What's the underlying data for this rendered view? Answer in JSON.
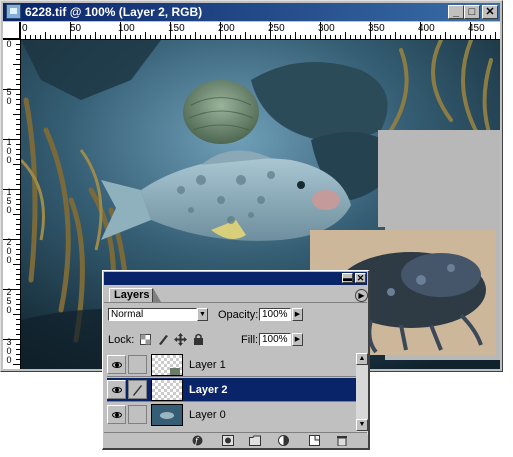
{
  "document": {
    "title": "6228.tif @ 100% (Layer 2, RGB)",
    "ruler_top_labels": [
      "0",
      "50",
      "100",
      "150",
      "200",
      "250",
      "300",
      "350",
      "400",
      "450"
    ],
    "ruler_left_labels": [
      "0",
      "50",
      "100",
      "150",
      "200",
      "250",
      "300"
    ]
  },
  "layers_panel": {
    "tab_label": "Layers",
    "blend_mode": "Normal",
    "opacity_label": "Opacity:",
    "opacity_value": "100%",
    "lock_label": "Lock:",
    "fill_label": "Fill:",
    "fill_value": "100%",
    "layers": [
      {
        "name": "Layer 1",
        "selected": false
      },
      {
        "name": "Layer 2",
        "selected": true
      },
      {
        "name": "Layer 0",
        "selected": false
      }
    ]
  },
  "colors": {
    "title_bar": "#0a246a",
    "selection": "#0a246a",
    "chrome": "#c0c0c0"
  }
}
